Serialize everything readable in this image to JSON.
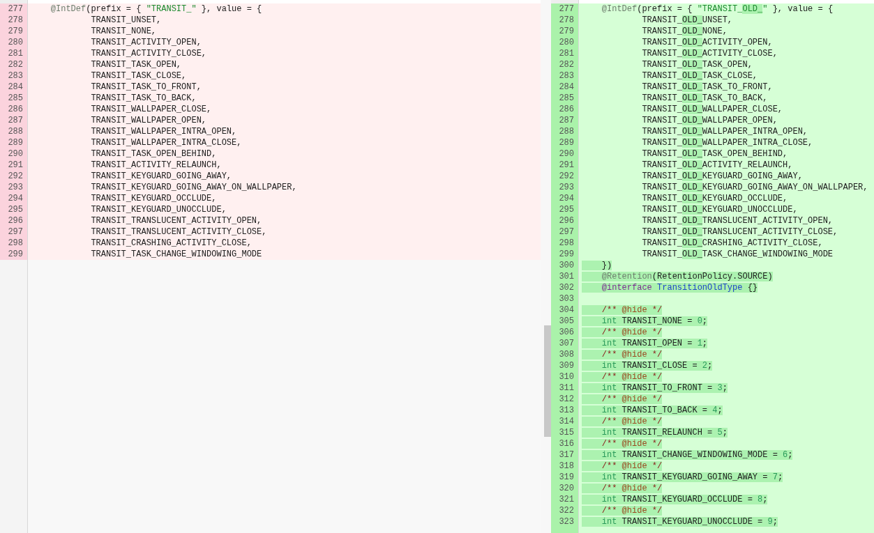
{
  "left_pane": {
    "lines": [
      {
        "number": "277",
        "kind": "removed",
        "segments": [
          {
            "text": "    @IntDef",
            "kind": "annotation",
            "highlight": false
          },
          {
            "text": "(prefix = { ",
            "kind": "plain",
            "highlight": false
          },
          {
            "text": "\"TRANSIT_\"",
            "kind": "string",
            "highlight": false
          },
          {
            "text": " }, value = {",
            "kind": "plain",
            "highlight": false
          }
        ]
      },
      {
        "number": "278",
        "kind": "removed",
        "segments": [
          {
            "text": "            TRANSIT_UNSET,",
            "kind": "plain",
            "highlight": false
          }
        ]
      },
      {
        "number": "279",
        "kind": "removed",
        "segments": [
          {
            "text": "            TRANSIT_NONE,",
            "kind": "plain",
            "highlight": false
          }
        ]
      },
      {
        "number": "280",
        "kind": "removed",
        "segments": [
          {
            "text": "            TRANSIT_ACTIVITY_OPEN,",
            "kind": "plain",
            "highlight": false
          }
        ]
      },
      {
        "number": "281",
        "kind": "removed",
        "segments": [
          {
            "text": "            TRANSIT_ACTIVITY_CLOSE,",
            "kind": "plain",
            "highlight": false
          }
        ]
      },
      {
        "number": "282",
        "kind": "removed",
        "segments": [
          {
            "text": "            TRANSIT_TASK_OPEN,",
            "kind": "plain",
            "highlight": false
          }
        ]
      },
      {
        "number": "283",
        "kind": "removed",
        "segments": [
          {
            "text": "            TRANSIT_TASK_CLOSE,",
            "kind": "plain",
            "highlight": false
          }
        ]
      },
      {
        "number": "284",
        "kind": "removed",
        "segments": [
          {
            "text": "            TRANSIT_TASK_TO_FRONT,",
            "kind": "plain",
            "highlight": false
          }
        ]
      },
      {
        "number": "285",
        "kind": "removed",
        "segments": [
          {
            "text": "            TRANSIT_TASK_TO_BACK,",
            "kind": "plain",
            "highlight": false
          }
        ]
      },
      {
        "number": "286",
        "kind": "removed",
        "segments": [
          {
            "text": "            TRANSIT_WALLPAPER_CLOSE,",
            "kind": "plain",
            "highlight": false
          }
        ]
      },
      {
        "number": "287",
        "kind": "removed",
        "segments": [
          {
            "text": "            TRANSIT_WALLPAPER_OPEN,",
            "kind": "plain",
            "highlight": false
          }
        ]
      },
      {
        "number": "288",
        "kind": "removed",
        "segments": [
          {
            "text": "            TRANSIT_WALLPAPER_INTRA_OPEN,",
            "kind": "plain",
            "highlight": false
          }
        ]
      },
      {
        "number": "289",
        "kind": "removed",
        "segments": [
          {
            "text": "            TRANSIT_WALLPAPER_INTRA_CLOSE,",
            "kind": "plain",
            "highlight": false
          }
        ]
      },
      {
        "number": "290",
        "kind": "removed",
        "segments": [
          {
            "text": "            TRANSIT_TASK_OPEN_BEHIND,",
            "kind": "plain",
            "highlight": false
          }
        ]
      },
      {
        "number": "291",
        "kind": "removed",
        "segments": [
          {
            "text": "            TRANSIT_ACTIVITY_RELAUNCH,",
            "kind": "plain",
            "highlight": false
          }
        ]
      },
      {
        "number": "292",
        "kind": "removed",
        "segments": [
          {
            "text": "            TRANSIT_KEYGUARD_GOING_AWAY,",
            "kind": "plain",
            "highlight": false
          }
        ]
      },
      {
        "number": "293",
        "kind": "removed",
        "segments": [
          {
            "text": "            TRANSIT_KEYGUARD_GOING_AWAY_ON_WALLPAPER,",
            "kind": "plain",
            "highlight": false
          }
        ]
      },
      {
        "number": "294",
        "kind": "removed",
        "segments": [
          {
            "text": "            TRANSIT_KEYGUARD_OCCLUDE,",
            "kind": "plain",
            "highlight": false
          }
        ]
      },
      {
        "number": "295",
        "kind": "removed",
        "segments": [
          {
            "text": "            TRANSIT_KEYGUARD_UNOCCLUDE,",
            "kind": "plain",
            "highlight": false
          }
        ]
      },
      {
        "number": "296",
        "kind": "removed",
        "segments": [
          {
            "text": "            TRANSIT_TRANSLUCENT_ACTIVITY_OPEN,",
            "kind": "plain",
            "highlight": false
          }
        ]
      },
      {
        "number": "297",
        "kind": "removed",
        "segments": [
          {
            "text": "            TRANSIT_TRANSLUCENT_ACTIVITY_CLOSE,",
            "kind": "plain",
            "highlight": false
          }
        ]
      },
      {
        "number": "298",
        "kind": "removed",
        "segments": [
          {
            "text": "            TRANSIT_CRASHING_ACTIVITY_CLOSE,",
            "kind": "plain",
            "highlight": false
          }
        ]
      },
      {
        "number": "299",
        "kind": "removed",
        "segments": [
          {
            "text": "            TRANSIT_TASK_CHANGE_WINDOWING_MODE",
            "kind": "plain",
            "highlight": false
          }
        ]
      }
    ]
  },
  "right_pane": {
    "lines": [
      {
        "number": "277",
        "kind": "added",
        "segments": [
          {
            "text": "    @IntDef",
            "kind": "annotation",
            "highlight": false
          },
          {
            "text": "(prefix = { ",
            "kind": "plain",
            "highlight": false
          },
          {
            "text": "\"TRANSIT_",
            "kind": "string",
            "highlight": false
          },
          {
            "text": "OLD_",
            "kind": "string",
            "highlight": true
          },
          {
            "text": "\"",
            "kind": "string",
            "highlight": false
          },
          {
            "text": " }, value = {",
            "kind": "plain",
            "highlight": false
          }
        ]
      },
      {
        "number": "278",
        "kind": "added",
        "segments": [
          {
            "text": "            TRANSIT_",
            "kind": "plain",
            "highlight": false
          },
          {
            "text": "OLD_",
            "kind": "plain",
            "highlight": true
          },
          {
            "text": "UNSET,",
            "kind": "plain",
            "highlight": false
          }
        ]
      },
      {
        "number": "279",
        "kind": "added",
        "segments": [
          {
            "text": "            TRANSIT_",
            "kind": "plain",
            "highlight": false
          },
          {
            "text": "OLD_",
            "kind": "plain",
            "highlight": true
          },
          {
            "text": "NONE,",
            "kind": "plain",
            "highlight": false
          }
        ]
      },
      {
        "number": "280",
        "kind": "added",
        "segments": [
          {
            "text": "            TRANSIT_",
            "kind": "plain",
            "highlight": false
          },
          {
            "text": "OLD_",
            "kind": "plain",
            "highlight": true
          },
          {
            "text": "ACTIVITY_OPEN,",
            "kind": "plain",
            "highlight": false
          }
        ]
      },
      {
        "number": "281",
        "kind": "added",
        "segments": [
          {
            "text": "            TRANSIT_",
            "kind": "plain",
            "highlight": false
          },
          {
            "text": "OLD_",
            "kind": "plain",
            "highlight": true
          },
          {
            "text": "ACTIVITY_CLOSE,",
            "kind": "plain",
            "highlight": false
          }
        ]
      },
      {
        "number": "282",
        "kind": "added",
        "segments": [
          {
            "text": "            TRANSIT_",
            "kind": "plain",
            "highlight": false
          },
          {
            "text": "OLD_",
            "kind": "plain",
            "highlight": true
          },
          {
            "text": "TASK_OPEN,",
            "kind": "plain",
            "highlight": false
          }
        ]
      },
      {
        "number": "283",
        "kind": "added",
        "segments": [
          {
            "text": "            TRANSIT_",
            "kind": "plain",
            "highlight": false
          },
          {
            "text": "OLD_",
            "kind": "plain",
            "highlight": true
          },
          {
            "text": "TASK_CLOSE,",
            "kind": "plain",
            "highlight": false
          }
        ]
      },
      {
        "number": "284",
        "kind": "added",
        "segments": [
          {
            "text": "            TRANSIT_",
            "kind": "plain",
            "highlight": false
          },
          {
            "text": "OLD_",
            "kind": "plain",
            "highlight": true
          },
          {
            "text": "TASK_TO_FRONT,",
            "kind": "plain",
            "highlight": false
          }
        ]
      },
      {
        "number": "285",
        "kind": "added",
        "segments": [
          {
            "text": "            TRANSIT_",
            "kind": "plain",
            "highlight": false
          },
          {
            "text": "OLD_",
            "kind": "plain",
            "highlight": true
          },
          {
            "text": "TASK_TO_BACK,",
            "kind": "plain",
            "highlight": false
          }
        ]
      },
      {
        "number": "286",
        "kind": "added",
        "segments": [
          {
            "text": "            TRANSIT_",
            "kind": "plain",
            "highlight": false
          },
          {
            "text": "OLD_",
            "kind": "plain",
            "highlight": true
          },
          {
            "text": "WALLPAPER_CLOSE,",
            "kind": "plain",
            "highlight": false
          }
        ]
      },
      {
        "number": "287",
        "kind": "added",
        "segments": [
          {
            "text": "            TRANSIT_",
            "kind": "plain",
            "highlight": false
          },
          {
            "text": "OLD_",
            "kind": "plain",
            "highlight": true
          },
          {
            "text": "WALLPAPER_OPEN,",
            "kind": "plain",
            "highlight": false
          }
        ]
      },
      {
        "number": "288",
        "kind": "added",
        "segments": [
          {
            "text": "            TRANSIT_",
            "kind": "plain",
            "highlight": false
          },
          {
            "text": "OLD_",
            "kind": "plain",
            "highlight": true
          },
          {
            "text": "WALLPAPER_INTRA_OPEN,",
            "kind": "plain",
            "highlight": false
          }
        ]
      },
      {
        "number": "289",
        "kind": "added",
        "segments": [
          {
            "text": "            TRANSIT_",
            "kind": "plain",
            "highlight": false
          },
          {
            "text": "OLD_",
            "kind": "plain",
            "highlight": true
          },
          {
            "text": "WALLPAPER_INTRA_CLOSE,",
            "kind": "plain",
            "highlight": false
          }
        ]
      },
      {
        "number": "290",
        "kind": "added",
        "segments": [
          {
            "text": "            TRANSIT_",
            "kind": "plain",
            "highlight": false
          },
          {
            "text": "OLD_",
            "kind": "plain",
            "highlight": true
          },
          {
            "text": "TASK_OPEN_BEHIND,",
            "kind": "plain",
            "highlight": false
          }
        ]
      },
      {
        "number": "291",
        "kind": "added",
        "segments": [
          {
            "text": "            TRANSIT_",
            "kind": "plain",
            "highlight": false
          },
          {
            "text": "OLD_",
            "kind": "plain",
            "highlight": true
          },
          {
            "text": "ACTIVITY_RELAUNCH,",
            "kind": "plain",
            "highlight": false
          }
        ]
      },
      {
        "number": "292",
        "kind": "added",
        "segments": [
          {
            "text": "            TRANSIT_",
            "kind": "plain",
            "highlight": false
          },
          {
            "text": "OLD_",
            "kind": "plain",
            "highlight": true
          },
          {
            "text": "KEYGUARD_GOING_AWAY,",
            "kind": "plain",
            "highlight": false
          }
        ]
      },
      {
        "number": "293",
        "kind": "added",
        "segments": [
          {
            "text": "            TRANSIT_",
            "kind": "plain",
            "highlight": false
          },
          {
            "text": "OLD_",
            "kind": "plain",
            "highlight": true
          },
          {
            "text": "KEYGUARD_GOING_AWAY_ON_WALLPAPER,",
            "kind": "plain",
            "highlight": false
          }
        ]
      },
      {
        "number": "294",
        "kind": "added",
        "segments": [
          {
            "text": "            TRANSIT_",
            "kind": "plain",
            "highlight": false
          },
          {
            "text": "OLD_",
            "kind": "plain",
            "highlight": true
          },
          {
            "text": "KEYGUARD_OCCLUDE,",
            "kind": "plain",
            "highlight": false
          }
        ]
      },
      {
        "number": "295",
        "kind": "added",
        "segments": [
          {
            "text": "            TRANSIT_",
            "kind": "plain",
            "highlight": false
          },
          {
            "text": "OLD_",
            "kind": "plain",
            "highlight": true
          },
          {
            "text": "KEYGUARD_UNOCCLUDE,",
            "kind": "plain",
            "highlight": false
          }
        ]
      },
      {
        "number": "296",
        "kind": "added",
        "segments": [
          {
            "text": "            TRANSIT_",
            "kind": "plain",
            "highlight": false
          },
          {
            "text": "OLD_",
            "kind": "plain",
            "highlight": true
          },
          {
            "text": "TRANSLUCENT_ACTIVITY_OPEN,",
            "kind": "plain",
            "highlight": false
          }
        ]
      },
      {
        "number": "297",
        "kind": "added",
        "segments": [
          {
            "text": "            TRANSIT_",
            "kind": "plain",
            "highlight": false
          },
          {
            "text": "OLD_",
            "kind": "plain",
            "highlight": true
          },
          {
            "text": "TRANSLUCENT_ACTIVITY_CLOSE,",
            "kind": "plain",
            "highlight": false
          }
        ]
      },
      {
        "number": "298",
        "kind": "added",
        "segments": [
          {
            "text": "            TRANSIT_",
            "kind": "plain",
            "highlight": false
          },
          {
            "text": "OLD_",
            "kind": "plain",
            "highlight": true
          },
          {
            "text": "CRASHING_ACTIVITY_CLOSE,",
            "kind": "plain",
            "highlight": false
          }
        ]
      },
      {
        "number": "299",
        "kind": "added",
        "segments": [
          {
            "text": "            TRANSIT_",
            "kind": "plain",
            "highlight": false
          },
          {
            "text": "OLD_",
            "kind": "plain",
            "highlight": true
          },
          {
            "text": "TASK_CHANGE_WINDOWING_MODE",
            "kind": "plain",
            "highlight": false
          }
        ]
      },
      {
        "number": "300",
        "kind": "added",
        "segments": [
          {
            "text": "    })",
            "kind": "plain",
            "highlight": true
          }
        ]
      },
      {
        "number": "301",
        "kind": "added",
        "segments": [
          {
            "text": "    @Retention",
            "kind": "annotation",
            "highlight": true
          },
          {
            "text": "(RetentionPolicy.SOURCE)",
            "kind": "plain",
            "highlight": true
          }
        ]
      },
      {
        "number": "302",
        "kind": "added",
        "segments": [
          {
            "text": "    @interface",
            "kind": "declaration",
            "highlight": true
          },
          {
            "text": " TransitionOldType",
            "kind": "type",
            "highlight": true
          },
          {
            "text": " {}",
            "kind": "plain",
            "highlight": true
          }
        ]
      },
      {
        "number": "303",
        "kind": "added"
      },
      {
        "number": "304",
        "kind": "added",
        "segments": [
          {
            "text": "    /** ",
            "kind": "comment",
            "highlight": true
          },
          {
            "text": "@hide",
            "kind": "doc-tag",
            "highlight": true
          },
          {
            "text": " */",
            "kind": "comment",
            "highlight": true
          }
        ]
      },
      {
        "number": "305",
        "kind": "added",
        "segments": [
          {
            "text": "    int",
            "kind": "keyword",
            "highlight": true
          },
          {
            "text": " TRANSIT_NONE = ",
            "kind": "plain",
            "highlight": true
          },
          {
            "text": "0",
            "kind": "number",
            "highlight": true
          },
          {
            "text": ";",
            "kind": "plain",
            "highlight": true
          }
        ]
      },
      {
        "number": "306",
        "kind": "added",
        "segments": [
          {
            "text": "    /** ",
            "kind": "comment",
            "highlight": true
          },
          {
            "text": "@hide",
            "kind": "doc-tag",
            "highlight": true
          },
          {
            "text": " */",
            "kind": "comment",
            "highlight": true
          }
        ]
      },
      {
        "number": "307",
        "kind": "added",
        "segments": [
          {
            "text": "    int",
            "kind": "keyword",
            "highlight": true
          },
          {
            "text": " TRANSIT_OPEN = ",
            "kind": "plain",
            "highlight": true
          },
          {
            "text": "1",
            "kind": "number",
            "highlight": true
          },
          {
            "text": ";",
            "kind": "plain",
            "highlight": true
          }
        ]
      },
      {
        "number": "308",
        "kind": "added",
        "segments": [
          {
            "text": "    /** ",
            "kind": "comment",
            "highlight": true
          },
          {
            "text": "@hide",
            "kind": "doc-tag",
            "highlight": true
          },
          {
            "text": " */",
            "kind": "comment",
            "highlight": true
          }
        ]
      },
      {
        "number": "309",
        "kind": "added",
        "segments": [
          {
            "text": "    int",
            "kind": "keyword",
            "highlight": true
          },
          {
            "text": " TRANSIT_CLOSE = ",
            "kind": "plain",
            "highlight": true
          },
          {
            "text": "2",
            "kind": "number",
            "highlight": true
          },
          {
            "text": ";",
            "kind": "plain",
            "highlight": true
          }
        ]
      },
      {
        "number": "310",
        "kind": "added",
        "segments": [
          {
            "text": "    /** ",
            "kind": "comment",
            "highlight": true
          },
          {
            "text": "@hide",
            "kind": "doc-tag",
            "highlight": true
          },
          {
            "text": " */",
            "kind": "comment",
            "highlight": true
          }
        ]
      },
      {
        "number": "311",
        "kind": "added",
        "segments": [
          {
            "text": "    int",
            "kind": "keyword",
            "highlight": true
          },
          {
            "text": " TRANSIT_TO_FRONT = ",
            "kind": "plain",
            "highlight": true
          },
          {
            "text": "3",
            "kind": "number",
            "highlight": true
          },
          {
            "text": ";",
            "kind": "plain",
            "highlight": true
          }
        ]
      },
      {
        "number": "312",
        "kind": "added",
        "segments": [
          {
            "text": "    /** ",
            "kind": "comment",
            "highlight": true
          },
          {
            "text": "@hide",
            "kind": "doc-tag",
            "highlight": true
          },
          {
            "text": " */",
            "kind": "comment",
            "highlight": true
          }
        ]
      },
      {
        "number": "313",
        "kind": "added",
        "segments": [
          {
            "text": "    int",
            "kind": "keyword",
            "highlight": true
          },
          {
            "text": " TRANSIT_TO_BACK = ",
            "kind": "plain",
            "highlight": true
          },
          {
            "text": "4",
            "kind": "number",
            "highlight": true
          },
          {
            "text": ";",
            "kind": "plain",
            "highlight": true
          }
        ]
      },
      {
        "number": "314",
        "kind": "added",
        "segments": [
          {
            "text": "    /** ",
            "kind": "comment",
            "highlight": true
          },
          {
            "text": "@hide",
            "kind": "doc-tag",
            "highlight": true
          },
          {
            "text": " */",
            "kind": "comment",
            "highlight": true
          }
        ]
      },
      {
        "number": "315",
        "kind": "added",
        "segments": [
          {
            "text": "    int",
            "kind": "keyword",
            "highlight": true
          },
          {
            "text": " TRANSIT_RELAUNCH = ",
            "kind": "plain",
            "highlight": true
          },
          {
            "text": "5",
            "kind": "number",
            "highlight": true
          },
          {
            "text": ";",
            "kind": "plain",
            "highlight": true
          }
        ]
      },
      {
        "number": "316",
        "kind": "added",
        "segments": [
          {
            "text": "    /** ",
            "kind": "comment",
            "highlight": true
          },
          {
            "text": "@hide",
            "kind": "doc-tag",
            "highlight": true
          },
          {
            "text": " */",
            "kind": "comment",
            "highlight": true
          }
        ]
      },
      {
        "number": "317",
        "kind": "added",
        "segments": [
          {
            "text": "    int",
            "kind": "keyword",
            "highlight": true
          },
          {
            "text": " TRANSIT_CHANGE_WINDOWING_MODE = ",
            "kind": "plain",
            "highlight": true
          },
          {
            "text": "6",
            "kind": "number",
            "highlight": true
          },
          {
            "text": ";",
            "kind": "plain",
            "highlight": true
          }
        ]
      },
      {
        "number": "318",
        "kind": "added",
        "segments": [
          {
            "text": "    /** ",
            "kind": "comment",
            "highlight": true
          },
          {
            "text": "@hide",
            "kind": "doc-tag",
            "highlight": true
          },
          {
            "text": " */",
            "kind": "comment",
            "highlight": true
          }
        ]
      },
      {
        "number": "319",
        "kind": "added",
        "segments": [
          {
            "text": "    int",
            "kind": "keyword",
            "highlight": true
          },
          {
            "text": " TRANSIT_KEYGUARD_GOING_AWAY = ",
            "kind": "plain",
            "highlight": true
          },
          {
            "text": "7",
            "kind": "number",
            "highlight": true
          },
          {
            "text": ";",
            "kind": "plain",
            "highlight": true
          }
        ]
      },
      {
        "number": "320",
        "kind": "added",
        "segments": [
          {
            "text": "    /** ",
            "kind": "comment",
            "highlight": true
          },
          {
            "text": "@hide",
            "kind": "doc-tag",
            "highlight": true
          },
          {
            "text": " */",
            "kind": "comment",
            "highlight": true
          }
        ]
      },
      {
        "number": "321",
        "kind": "added",
        "segments": [
          {
            "text": "    int",
            "kind": "keyword",
            "highlight": true
          },
          {
            "text": " TRANSIT_KEYGUARD_OCCLUDE = ",
            "kind": "plain",
            "highlight": true
          },
          {
            "text": "8",
            "kind": "number",
            "highlight": true
          },
          {
            "text": ";",
            "kind": "plain",
            "highlight": true
          }
        ]
      },
      {
        "number": "322",
        "kind": "added",
        "segments": [
          {
            "text": "    /** ",
            "kind": "comment",
            "highlight": true
          },
          {
            "text": "@hide",
            "kind": "doc-tag",
            "highlight": true
          },
          {
            "text": " */",
            "kind": "comment",
            "highlight": true
          }
        ]
      },
      {
        "number": "323",
        "kind": "added",
        "segments": [
          {
            "text": "    int",
            "kind": "keyword",
            "highlight": true
          },
          {
            "text": " TRANSIT_KEYGUARD_UNOCCLUDE = ",
            "kind": "plain",
            "highlight": true
          },
          {
            "text": "9",
            "kind": "number",
            "highlight": true
          },
          {
            "text": ";",
            "kind": "plain",
            "highlight": true
          }
        ]
      }
    ]
  }
}
